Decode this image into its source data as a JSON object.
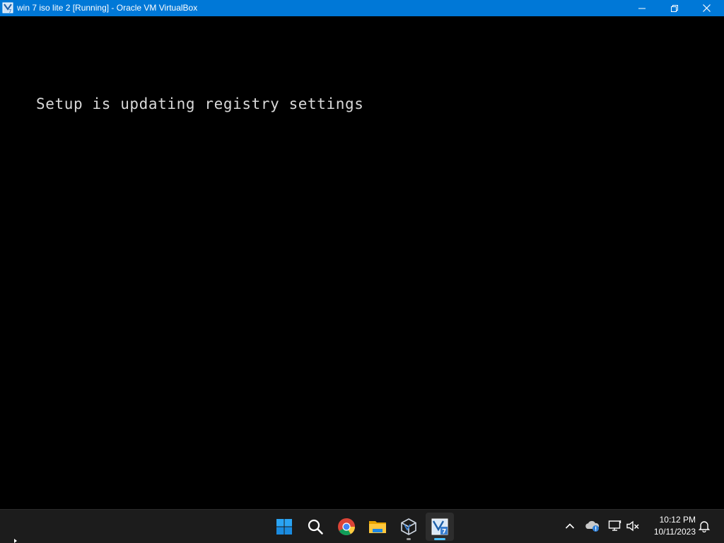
{
  "window": {
    "title": "win 7 iso lite 2 [Running] - Oracle VM VirtualBox",
    "controls": [
      "minimize",
      "restore",
      "close"
    ],
    "titlebar_color": "#0078d7"
  },
  "vm": {
    "console_text": "Setup is updating registry settings",
    "text_color": "#d9d9d9",
    "background_color": "#000000"
  },
  "taskbar": {
    "apps": [
      {
        "name": "start",
        "icon": "windows-logo-icon"
      },
      {
        "name": "search",
        "icon": "search-icon"
      },
      {
        "name": "chrome",
        "icon": "chrome-icon"
      },
      {
        "name": "file-explorer",
        "icon": "folder-icon"
      },
      {
        "name": "virtualbox-manager",
        "icon": "virtualbox-icon",
        "state": "open"
      },
      {
        "name": "virtualbox-vm",
        "icon": "vm-window-icon",
        "state": "active"
      }
    ],
    "tray_icons": [
      "chevron-up-icon",
      "onedrive-icon",
      "network-icon",
      "volume-muted-icon",
      "notification-bell-icon"
    ],
    "clock": {
      "time": "10:12 PM",
      "date": "10/11/2023"
    },
    "accent_color": "#4cc2ff"
  }
}
